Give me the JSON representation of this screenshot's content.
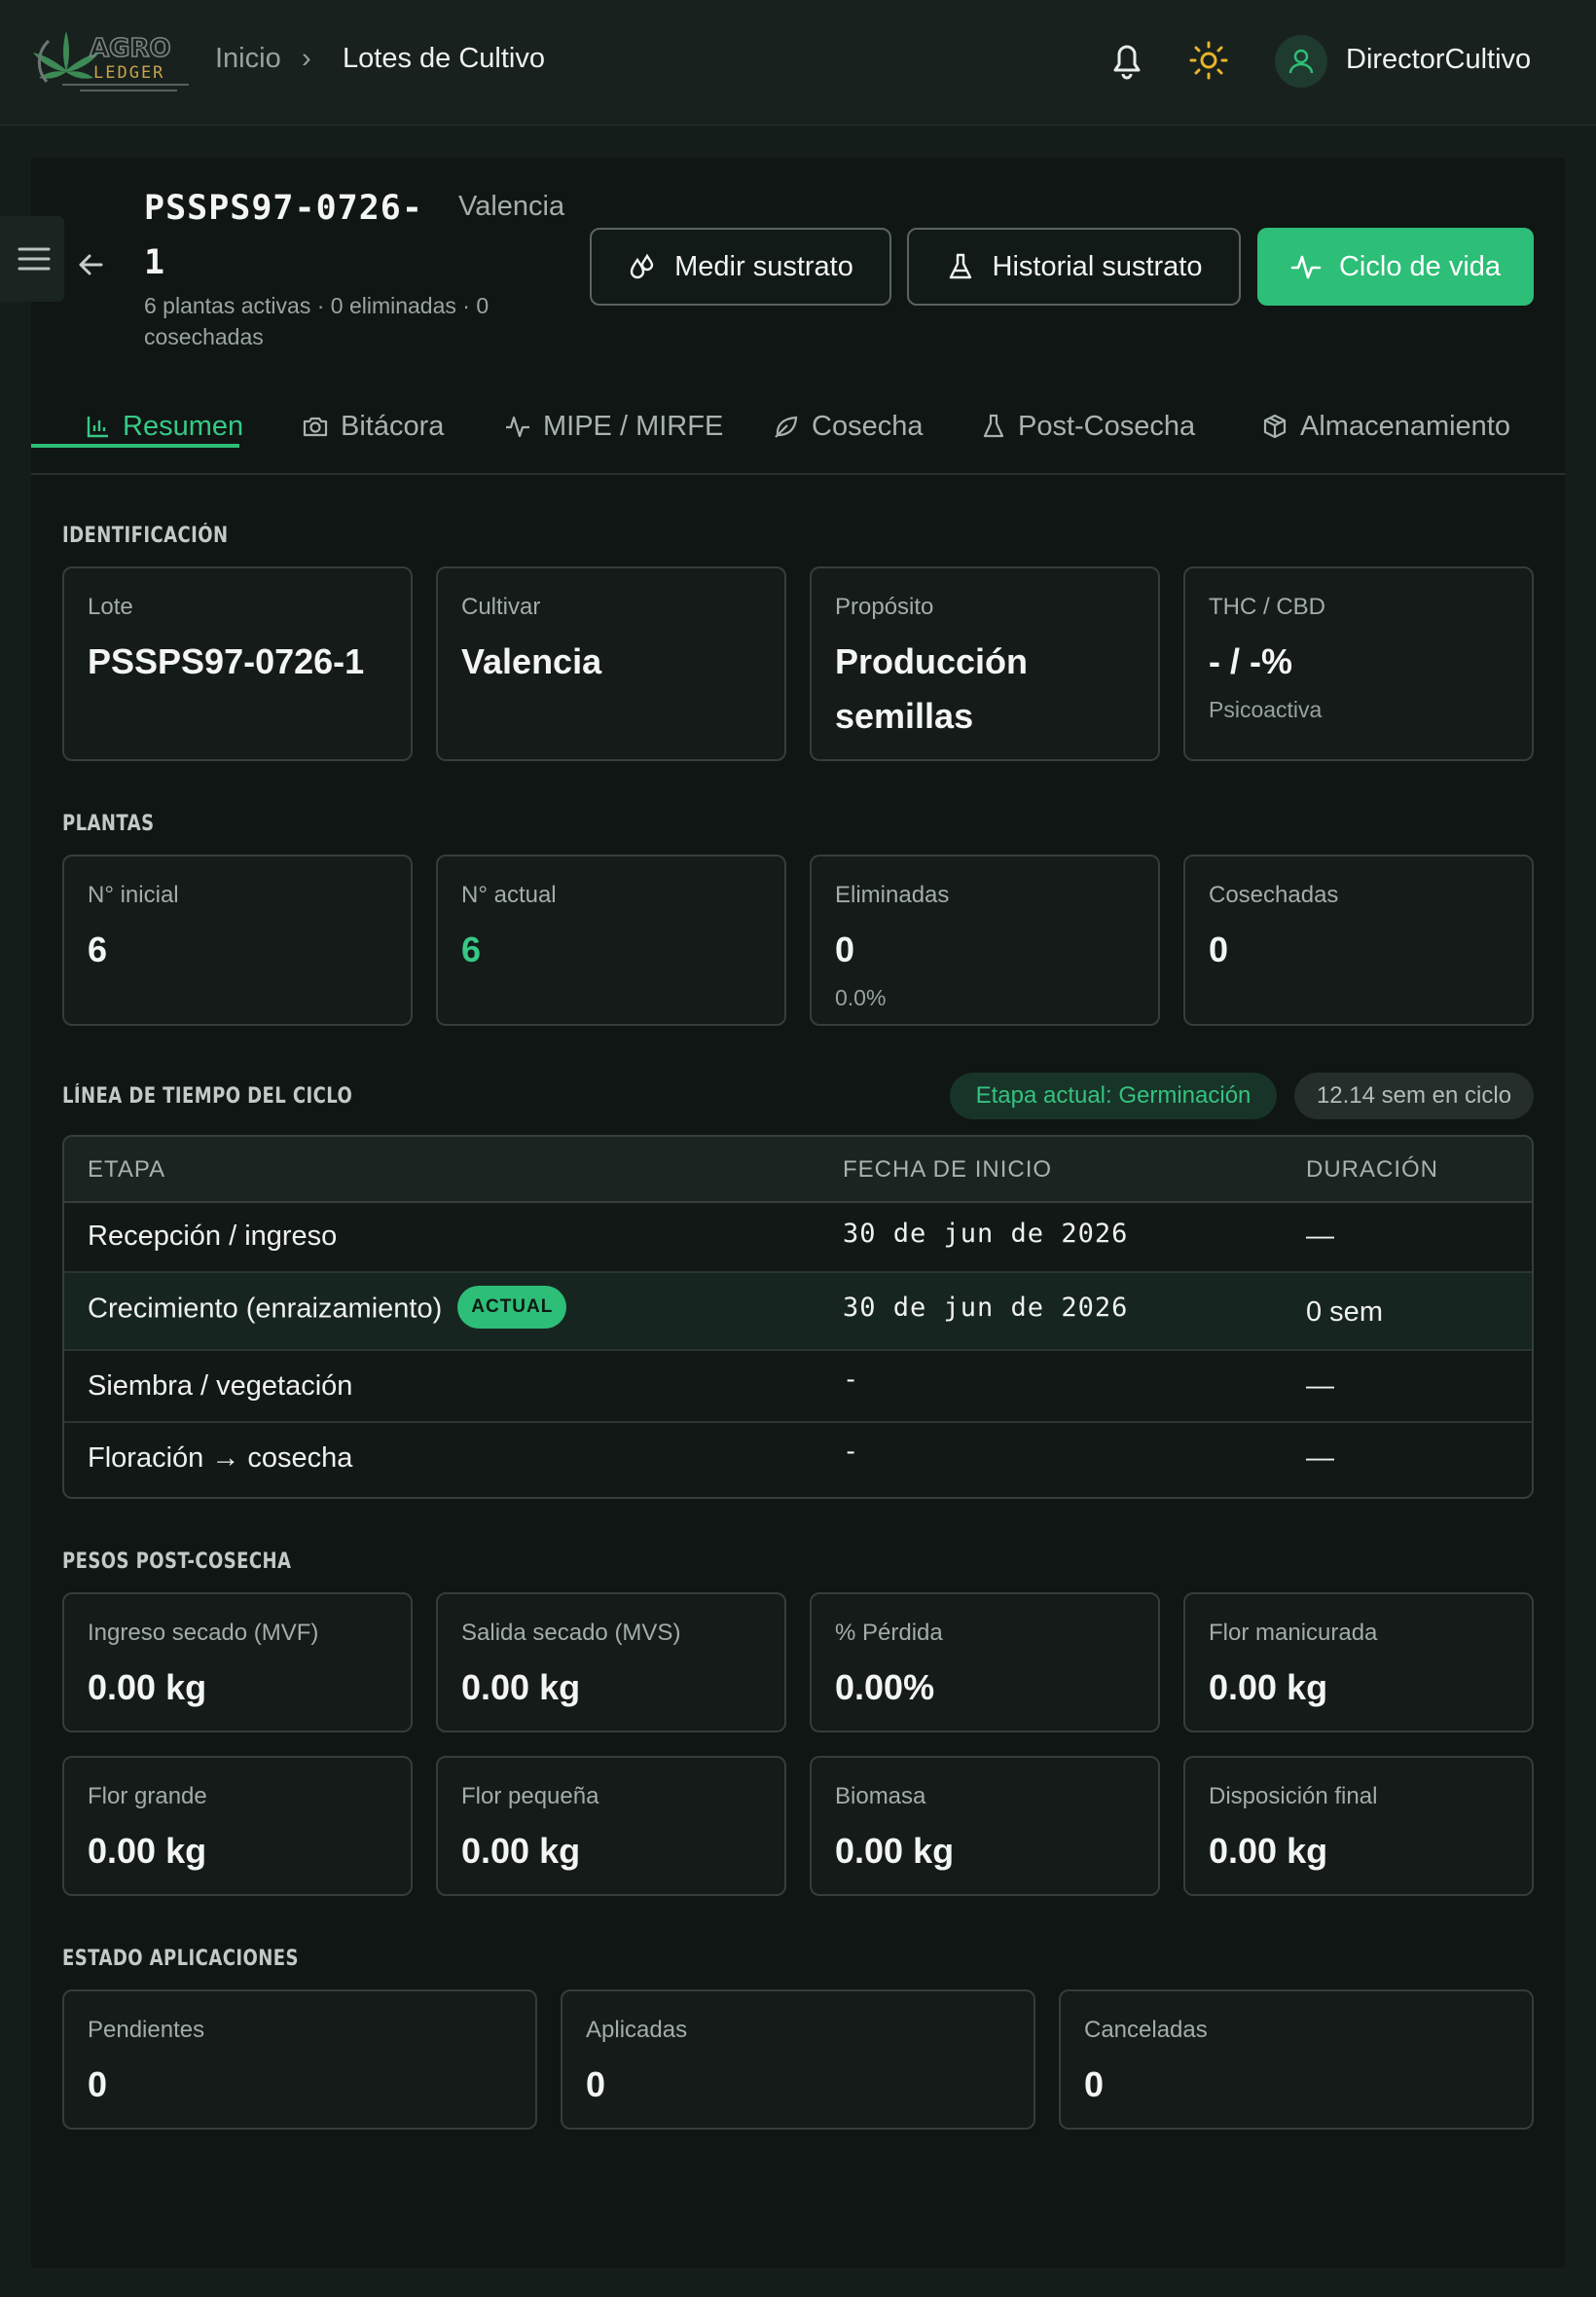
{
  "brand": {
    "name": "AGRO LEDGER"
  },
  "breadcrumb": {
    "home": "Inicio",
    "separator": "›",
    "current": "Lotes de Cultivo"
  },
  "user": {
    "name": "DirectorCultivo"
  },
  "lot": {
    "code": "PSSPS97-0726-1",
    "cultivar": "Valencia",
    "summary": "6 plantas activas · 0 eliminadas · 0 cosechadas"
  },
  "actions": {
    "measure": "Medir sustrato",
    "history": "Historial sustrato",
    "lifecycle": "Ciclo de vida"
  },
  "tabs": [
    "Resumen",
    "Bitácora",
    "MIPE / MIRFE",
    "Cosecha",
    "Post-Cosecha",
    "Almacenamiento"
  ],
  "identification": {
    "title": "IDENTIFICACIÓN",
    "cards": [
      {
        "label": "Lote",
        "value": "PSSPS97-0726-1"
      },
      {
        "label": "Cultivar",
        "value": "Valencia"
      },
      {
        "label": "Propósito",
        "value": "Producción semillas"
      },
      {
        "label": "THC / CBD",
        "value": "- / -%",
        "sub": "Psicoactiva"
      }
    ]
  },
  "plants": {
    "title": "PLANTAS",
    "cards": [
      {
        "label": "N° inicial",
        "value": "6"
      },
      {
        "label": "N° actual",
        "value": "6"
      },
      {
        "label": "Eliminadas",
        "value": "0",
        "sub": "0.0%"
      },
      {
        "label": "Cosechadas",
        "value": "0"
      }
    ]
  },
  "timeline": {
    "title": "LÍNEA DE TIEMPO DEL CICLO",
    "current_stage": "Etapa actual: Germinación",
    "weeks": "12.14 sem en ciclo",
    "columns": [
      "ETAPA",
      "FECHA DE INICIO",
      "DURACIÓN"
    ],
    "badge": "ACTUAL",
    "rows": [
      {
        "stage": "Recepción / ingreso",
        "start": "30 de jun de 2026",
        "duration": "—"
      },
      {
        "stage": "Crecimiento (enraizamiento)",
        "start": "30 de jun de 2026",
        "duration": "0 sem"
      },
      {
        "stage": "Siembra / vegetación",
        "start": "-",
        "duration": "—"
      },
      {
        "stage": "Floración → cosecha",
        "start": "-",
        "duration": "—"
      }
    ]
  },
  "weights": {
    "title": "PESOS POST-COSECHA",
    "cards": [
      {
        "label": "Ingreso secado (MVF)",
        "value": "0.00 kg"
      },
      {
        "label": "Salida secado (MVS)",
        "value": "0.00 kg"
      },
      {
        "label": "% Pérdida",
        "value": "0.00%"
      },
      {
        "label": "Flor manicurada",
        "value": "0.00 kg"
      },
      {
        "label": "Flor grande",
        "value": "0.00 kg"
      },
      {
        "label": "Flor pequeña",
        "value": "0.00 kg"
      },
      {
        "label": "Biomasa",
        "value": "0.00 kg"
      },
      {
        "label": "Disposición final",
        "value": "0.00 kg"
      }
    ]
  },
  "applications": {
    "title": "ESTADO APLICACIONES",
    "cards": [
      {
        "label": "Pendientes",
        "value": "0"
      },
      {
        "label": "Aplicadas",
        "value": "0"
      },
      {
        "label": "Canceladas",
        "value": "0"
      }
    ]
  },
  "colors": {
    "accent": "#2dbe77",
    "background": "#151d1a",
    "panel": "#101614"
  }
}
